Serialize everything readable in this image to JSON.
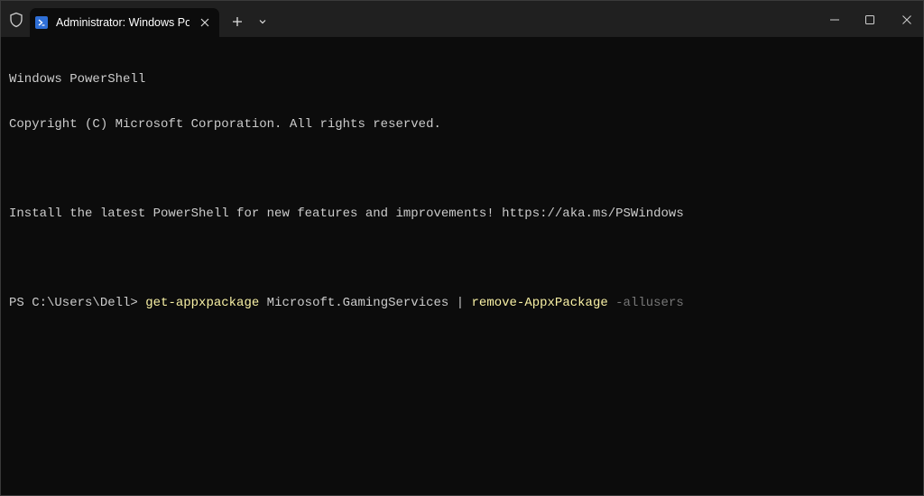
{
  "window": {
    "tab_title": "Administrator: Windows PowerShell",
    "tab_icon": "powershell-icon",
    "shield_icon": "shield-icon",
    "new_tab_icon": "plus-icon",
    "dropdown_icon": "chevron-down-icon",
    "minimize_icon": "minimize-icon",
    "maximize_icon": "maximize-icon",
    "close_icon": "close-icon"
  },
  "terminal": {
    "lines": [
      "Windows PowerShell",
      "Copyright (C) Microsoft Corporation. All rights reserved.",
      "",
      "Install the latest PowerShell for new features and improvements! https://aka.ms/PSWindows",
      ""
    ],
    "prompt": "PS C:\\Users\\Dell> ",
    "command": {
      "cmdlet1": "get-appxpackage",
      "arg1": " Microsoft.GamingServices | ",
      "cmdlet2": "remove-AppxPackage",
      "param": " -allusers"
    }
  },
  "colors": {
    "background": "#0c0c0c",
    "titlebar": "#202020",
    "text": "#cccccc",
    "cmdlet": "#f9f1a5",
    "parameter": "#767676"
  }
}
